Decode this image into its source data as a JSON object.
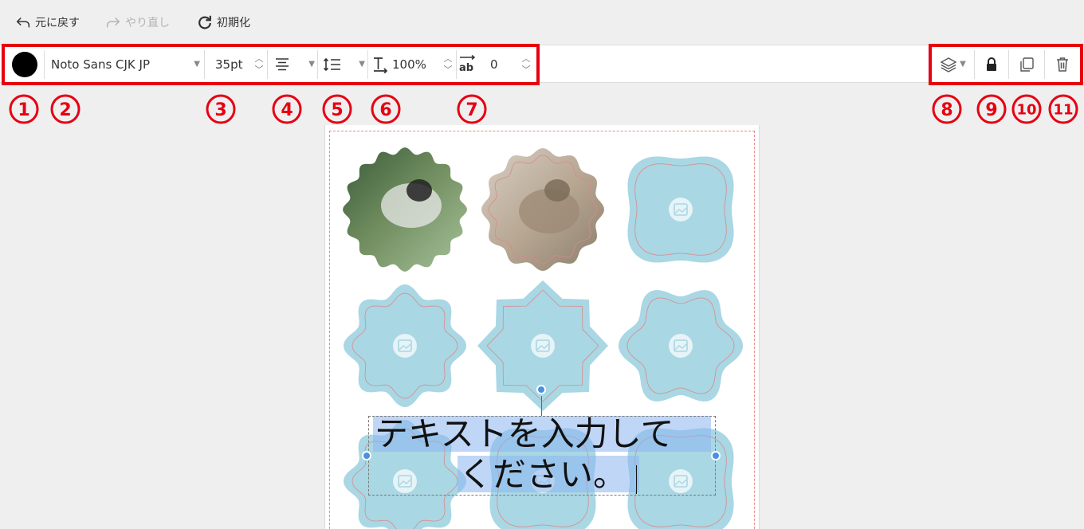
{
  "topbar": {
    "undo_label": "元に戻す",
    "redo_label": "やり直し",
    "reset_label": "初期化"
  },
  "toolbar": {
    "color": "#000000",
    "font_family_value": "Noto Sans CJK JP",
    "font_size_value": "35pt",
    "line_height_value": "100%",
    "letter_spacing_value": "0"
  },
  "annotations": {
    "color": "#e60012",
    "numbers": [
      "1",
      "2",
      "3",
      "4",
      "5",
      "6",
      "7",
      "8",
      "9",
      "10",
      "11"
    ]
  },
  "canvas": {
    "shape_color": "#a9d7e4",
    "text_line_1": "テキストを入力して",
    "text_line_2": "ください。"
  }
}
